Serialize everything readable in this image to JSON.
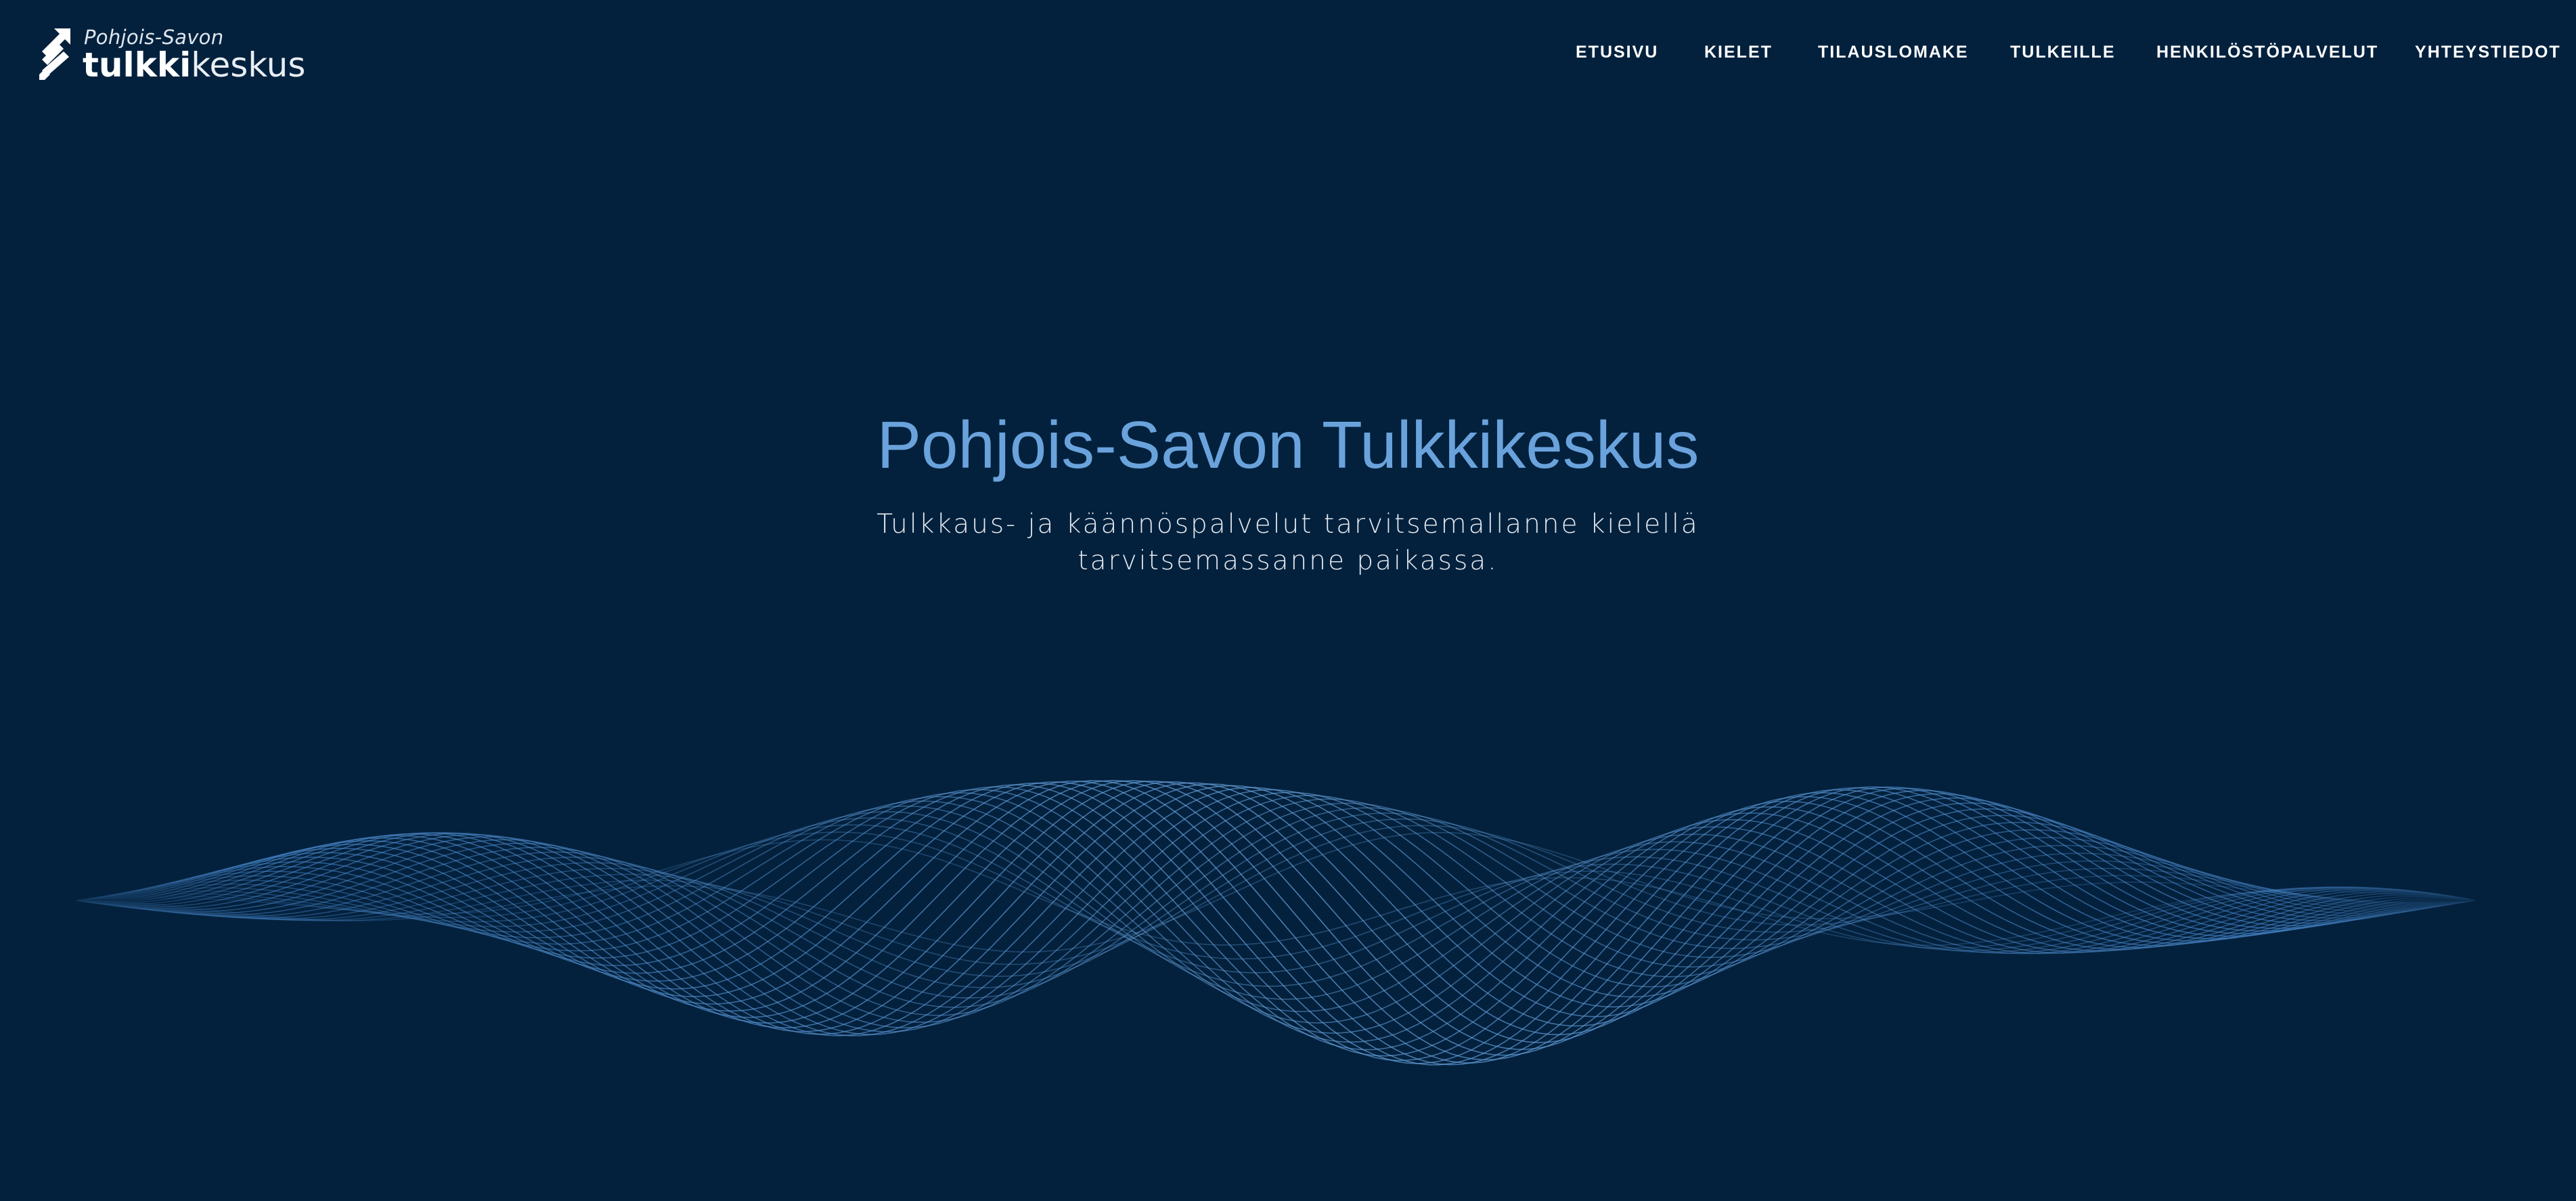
{
  "logo": {
    "subtitle": "Pohjois-Savon",
    "name_bold": "tulkki",
    "name_light": "keskus",
    "icon": "arrow-stripes-icon"
  },
  "nav": {
    "items": [
      {
        "label": "ETUSIVU"
      },
      {
        "label": "KIELET"
      },
      {
        "label": "TILAUSLOMAKE"
      },
      {
        "label": "TULKEILLE"
      },
      {
        "label": "HENKILÖSTÖPALVELUT"
      },
      {
        "label": "YHTEYSTIEDOT"
      }
    ]
  },
  "hero": {
    "title": "Pohjois-Savon Tulkkikeskus",
    "subtitle_line1": "Tulkkaus- ja käännöspalvelut tarvitsemallanne kielellä",
    "subtitle_line2": "tarvitsemassanne paikassa."
  },
  "colors": {
    "background": "#03213d",
    "title": "#6aa3dc",
    "wave": "#4a8ad0",
    "nav_text": "#ffffff"
  }
}
